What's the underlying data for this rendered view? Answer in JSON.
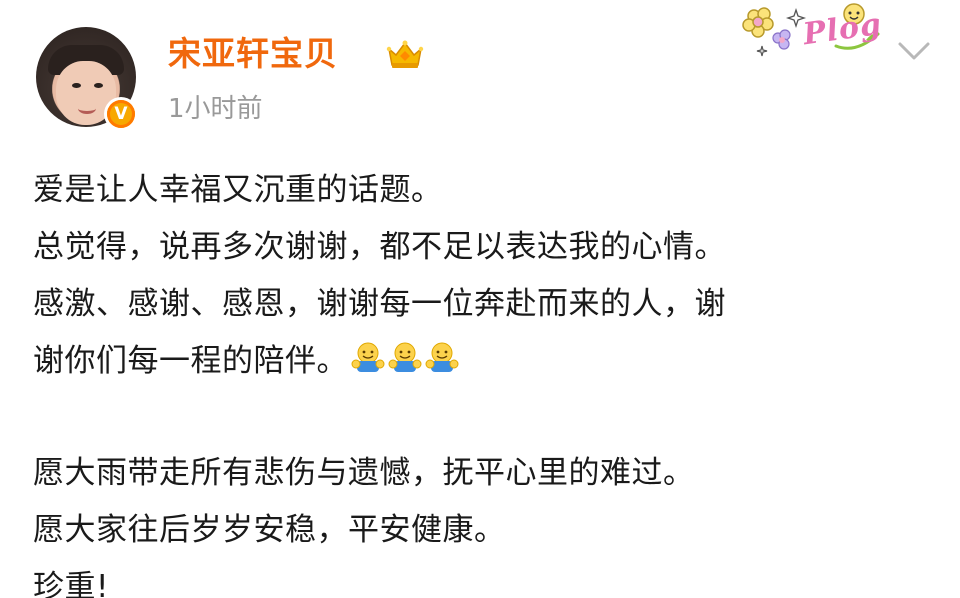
{
  "post": {
    "username": "宋亚轩宝贝",
    "timestamp": "1小时前",
    "verified_badge": "V",
    "sticker_text": "Plog",
    "icons": {
      "avatar": "profile-photo",
      "verified": "verified-v-icon",
      "crown": "fan-crown-icon",
      "sticker": "plog-sticker-icon",
      "menu": "chevron-down-icon",
      "emoji": "hug-emoji-icon"
    },
    "colors": {
      "username": "#f0680d",
      "timestamp": "#999999",
      "text": "#1a1a1a",
      "verified": "#f7a800"
    },
    "body": {
      "p1": [
        "爱是让人幸福又沉重的话题。",
        "总觉得，说再多次谢谢，都不足以表达我的心情。",
        "感激、感谢、感恩，谢谢每一位奔赴而来的人，谢",
        "谢你们每一程的陪伴。"
      ],
      "p2": [
        "愿大雨带走所有悲伤与遗憾，抚平心里的难过。",
        "愿大家往后岁岁安稳，平安健康。",
        "珍重!"
      ],
      "emoji_count": 3
    }
  }
}
